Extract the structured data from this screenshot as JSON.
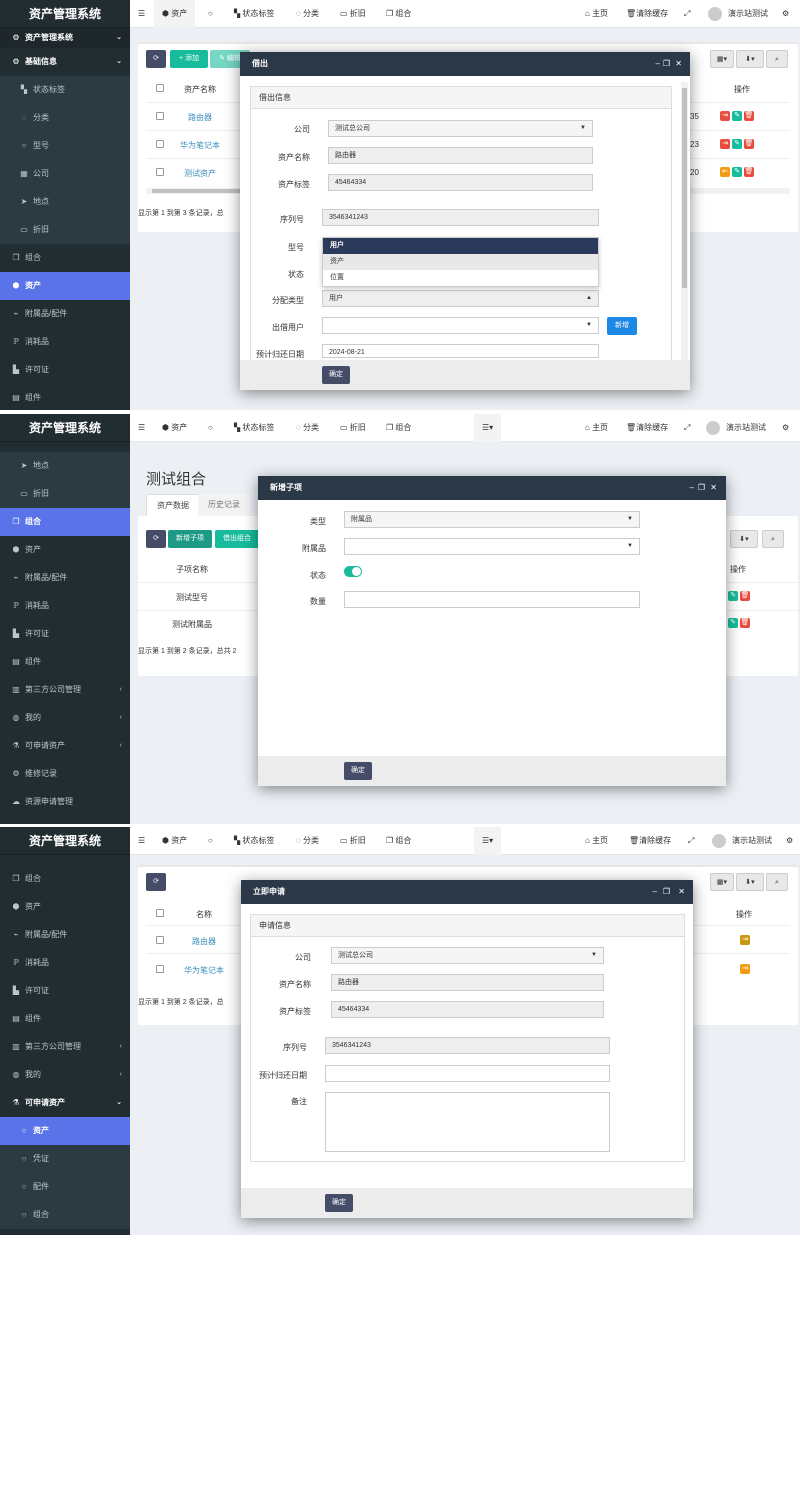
{
  "app_title": "资产管理系统",
  "topbar": {
    "menu_icon": "menu-icon",
    "tab_assets": "资产",
    "tab_status": "状态标签",
    "tab_category": "分类",
    "tab_depreciation": "折旧",
    "tab_combo": "组合",
    "home": "主页",
    "clear_cache": "清除缓存",
    "user": "演示站测试"
  },
  "panel1": {
    "sidebar": {
      "group": "资产管理系统",
      "items": [
        "基础信息",
        "状态标签",
        "分类",
        "型号",
        "公司",
        "地点",
        "折旧",
        "组合",
        "资产",
        "附属品/配件",
        "消耗品",
        "许可证",
        "组件"
      ]
    },
    "toolbar": {
      "add": "添加",
      "edit": "编辑"
    },
    "table": {
      "headers": [
        "资产名称",
        "操作"
      ],
      "rows": [
        {
          "name": "路由器",
          "tail": "35"
        },
        {
          "name": "华为笔记本",
          "tail": "23"
        },
        {
          "name": "测试资产",
          "tail": "20"
        }
      ],
      "footer": "显示第 1 到第 3 条记录，总"
    },
    "modal": {
      "title": "借出",
      "section": "借出信息",
      "fields": {
        "company_label": "公司",
        "company_value": "测试总公司",
        "asset_name_label": "资产名称",
        "asset_name_value": "路由器",
        "asset_tag_label": "资产标签",
        "asset_tag_value": "45464334",
        "serial_label": "序列号",
        "serial_value": "3546341243",
        "model_label": "型号",
        "status_label": "状态",
        "assign_type_label": "分配类型",
        "assign_type_value": "用户",
        "checkout_user_label": "出借用户",
        "return_date_label": "预计归还日期",
        "return_date_value": "2024-08-21"
      },
      "dropdown_options": [
        "用户",
        "资产",
        "位置"
      ],
      "new_button": "新增",
      "confirm": "确定"
    }
  },
  "panel2": {
    "sidebar": {
      "items": [
        "地点",
        "折旧",
        "组合",
        "资产",
        "附属品/配件",
        "消耗品",
        "许可证",
        "组件",
        "第三方公司管理",
        "我的",
        "可申请资产",
        "维修记录",
        "资源申请管理"
      ]
    },
    "page_title": "测试组合",
    "tabs": [
      "资产数据",
      "历史记录"
    ],
    "toolbar": {
      "add_child": "新增子项",
      "checkout_combo": "借出组合"
    },
    "table": {
      "headers": [
        "子项名称",
        "操作"
      ],
      "rows": [
        "测试型号",
        "测试附属品"
      ],
      "footer": "显示第 1 到第 2 条记录，总共 2"
    },
    "modal": {
      "title": "新增子项",
      "type_label": "类型",
      "type_value": "附属品",
      "accessory_label": "附属品",
      "accessory_value": "",
      "status_label": "状态",
      "status_on": true,
      "qty_label": "数量",
      "qty_value": "",
      "confirm": "确定"
    }
  },
  "panel3": {
    "sidebar": {
      "items": [
        "组合",
        "资产",
        "附属品/配件",
        "消耗品",
        "许可证",
        "组件",
        "第三方公司管理",
        "我的",
        "可申请资产",
        "资产",
        "凭证",
        "配件",
        "组合"
      ]
    },
    "table": {
      "headers": [
        "名称",
        "操作"
      ],
      "rows": [
        "路由器",
        "华为笔记本"
      ],
      "footer": "显示第 1 到第 2 条记录，总"
    },
    "modal": {
      "title": "立即申请",
      "section": "申请信息",
      "company_label": "公司",
      "company_value": "测试总公司",
      "asset_name_label": "资产名称",
      "asset_name_value": "路由器",
      "asset_tag_label": "资产标签",
      "asset_tag_value": "45464334",
      "serial_label": "序列号",
      "serial_value": "3546341243",
      "return_date_label": "预计归还日期",
      "return_date_value": "",
      "notes_label": "备注",
      "notes_value": "",
      "confirm": "确定"
    }
  },
  "colors": {
    "sidebar_bg": "#222d32",
    "active_blue": "#5a73e8",
    "modal_header": "#2b3847",
    "success": "#18bc9c",
    "danger": "#e74c3c",
    "warning": "#f39c12"
  }
}
